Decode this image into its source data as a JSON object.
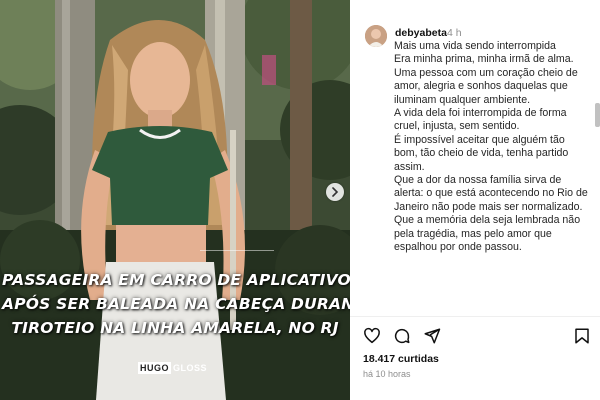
{
  "media": {
    "headline_lines": [
      "PASSAGEIRA EM CARRO DE APLICATIVO MORRE",
      "APÓS SER BALEADA NA CABEÇA DURANTE",
      "TIROTEIO NA LINHA AMARELA, NO RJ"
    ],
    "watermark_left": "HUGO",
    "watermark_right": "GLOSS",
    "icons": {
      "next": "chevron-right-icon"
    }
  },
  "post": {
    "username": "debyabeta",
    "time": "4 h",
    "caption": [
      "Mais uma vida sendo interrompida",
      "Era minha prima, minha irmã de alma.",
      "Uma pessoa com um coração cheio de amor, alegria e sonhos daquelas que iluminam qualquer ambiente.",
      "A vida dela foi interrompida de forma cruel, injusta, sem sentido.",
      "É impossível aceitar que alguém tão bom, tão cheio de vida, tenha partido assim.",
      "Que a dor da nossa família sirva de alerta: o que está acontecendo no Rio de Janeiro não pode mais ser normalizado.",
      "Que a memória dela seja lembrada não pela tragédia, mas pelo amor que espalhou por onde passou."
    ],
    "likes_count": "18.417",
    "likes_label": "curtidas",
    "posted_ago": "há 10 horas",
    "icons": {
      "like": "heart-icon",
      "comment": "comment-icon",
      "share": "send-icon",
      "save": "bookmark-icon"
    }
  },
  "colors": {
    "text": "#262626",
    "muted": "#8e8e8e",
    "divider": "#efefef"
  }
}
